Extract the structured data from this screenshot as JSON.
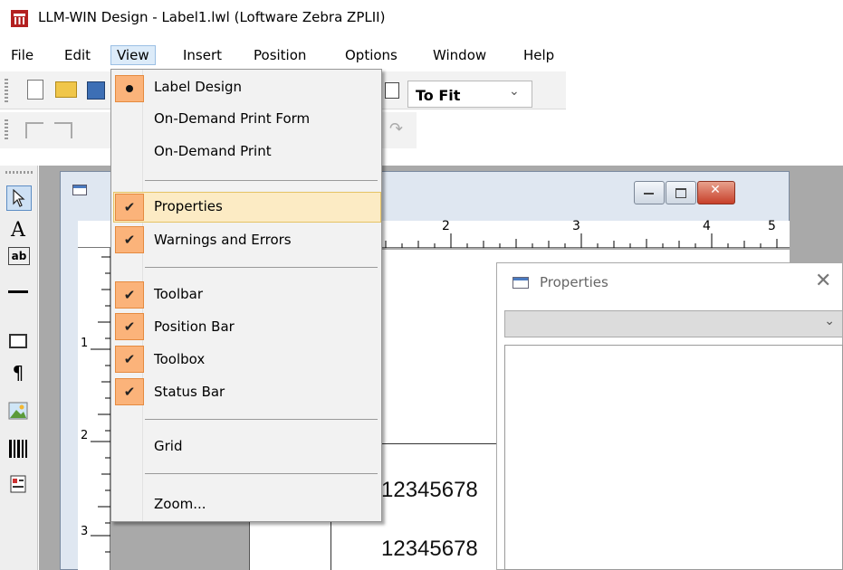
{
  "window": {
    "title": "LLM-WIN Design - Label1.lwl (Loftware Zebra ZPLII)"
  },
  "menubar": [
    {
      "label": "File"
    },
    {
      "label": "Edit"
    },
    {
      "label": "View"
    },
    {
      "label": "Insert"
    },
    {
      "label": "Position"
    },
    {
      "label": "Options"
    },
    {
      "label": "Window"
    },
    {
      "label": "Help"
    }
  ],
  "toolbar": {
    "zoom_value": "To Fit"
  },
  "view_menu": {
    "items": [
      {
        "label": "Label Design",
        "state": "radio-selected"
      },
      {
        "label": "On-Demand Print Form",
        "state": "none"
      },
      {
        "label": "On-Demand Print",
        "state": "none"
      },
      {
        "label": "Properties",
        "state": "checked",
        "highlighted": true
      },
      {
        "label": "Warnings and Errors",
        "state": "checked"
      },
      {
        "label": "Toolbar",
        "state": "checked"
      },
      {
        "label": "Position Bar",
        "state": "checked"
      },
      {
        "label": "Toolbox",
        "state": "checked"
      },
      {
        "label": "Status Bar",
        "state": "checked"
      },
      {
        "label": "Grid",
        "state": "none"
      },
      {
        "label": "Zoom...",
        "state": "none"
      }
    ]
  },
  "ruler": {
    "horizontal_marks": [
      "2",
      "3",
      "4",
      "5"
    ],
    "vertical_marks": [
      "1",
      "2",
      "3"
    ]
  },
  "label": {
    "line1": "12345678",
    "line2": "12345678"
  },
  "properties_panel": {
    "title": "Properties"
  },
  "colors": {
    "menu_highlight": "#fcebc4",
    "check_bg": "#fbb37a",
    "close_red": "#c7402a"
  }
}
